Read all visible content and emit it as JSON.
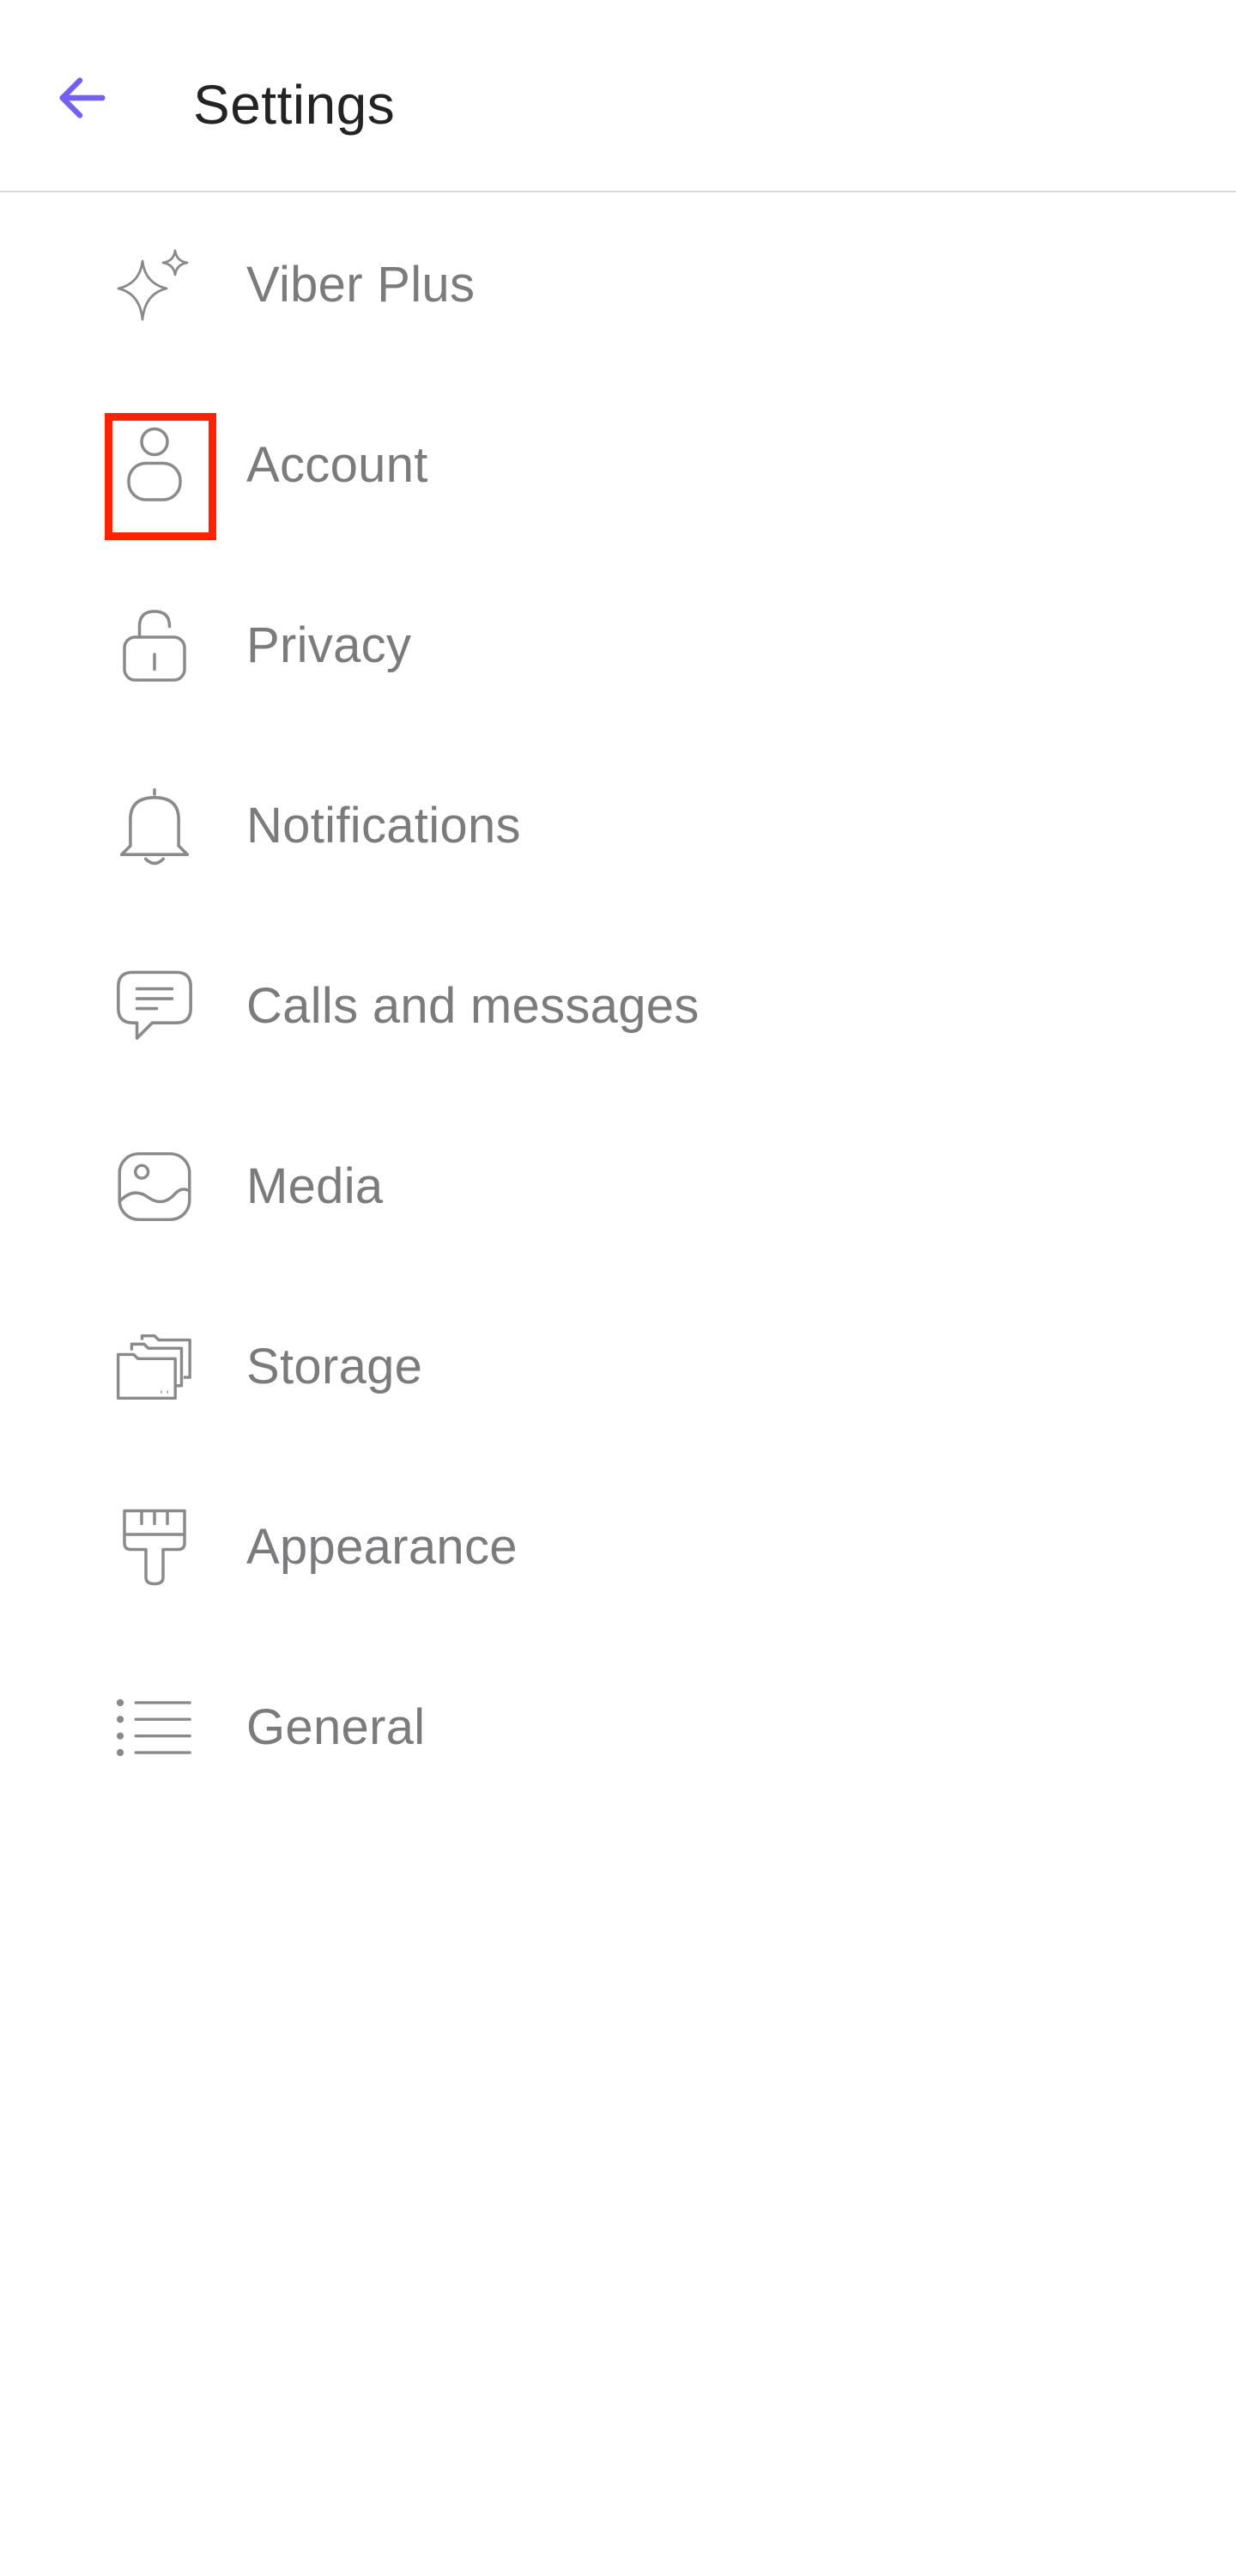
{
  "header": {
    "title": "Settings",
    "back_icon": "arrow-left-icon",
    "accent_color": "#7360f2"
  },
  "settings": {
    "items": [
      {
        "label": "Viber Plus",
        "icon": "sparkle-icon"
      },
      {
        "label": "Account",
        "icon": "person-icon"
      },
      {
        "label": "Privacy",
        "icon": "lock-icon"
      },
      {
        "label": "Notifications",
        "icon": "bell-icon"
      },
      {
        "label": "Calls and messages",
        "icon": "chat-bubble-icon"
      },
      {
        "label": "Media",
        "icon": "image-icon"
      },
      {
        "label": "Storage",
        "icon": "folders-icon"
      },
      {
        "label": "Appearance",
        "icon": "paintbrush-icon"
      },
      {
        "label": "General",
        "icon": "list-icon"
      }
    ],
    "highlighted_item": "Account",
    "highlight_color": "#ff2200",
    "text_color": "#7b7b7e",
    "icon_color": "#8a8a8d"
  }
}
